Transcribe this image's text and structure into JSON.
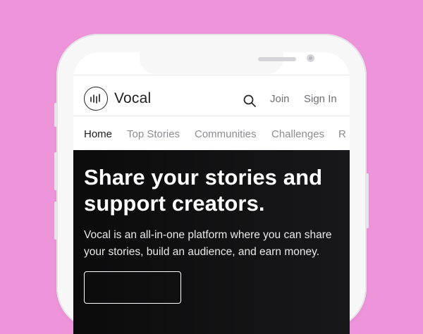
{
  "brand": {
    "name": "Vocal",
    "logo_icon": "sound-wave-circle-icon"
  },
  "header": {
    "search_icon": "search-icon",
    "join_label": "Join",
    "signin_label": "Sign In"
  },
  "nav": {
    "items": [
      {
        "label": "Home",
        "active": true
      },
      {
        "label": "Top Stories",
        "active": false
      },
      {
        "label": "Communities",
        "active": false
      },
      {
        "label": "Challenges",
        "active": false
      },
      {
        "label": "R",
        "active": false
      }
    ]
  },
  "hero": {
    "title": "Share your stories and support creators.",
    "description": "Vocal is an all-in-one platform where you can share your stories, build an audience, and earn money."
  },
  "colors": {
    "background": "#ee94da",
    "hero_bg": "#111112",
    "text_dark": "#1d1d1f",
    "text_muted": "#8c8c93"
  }
}
